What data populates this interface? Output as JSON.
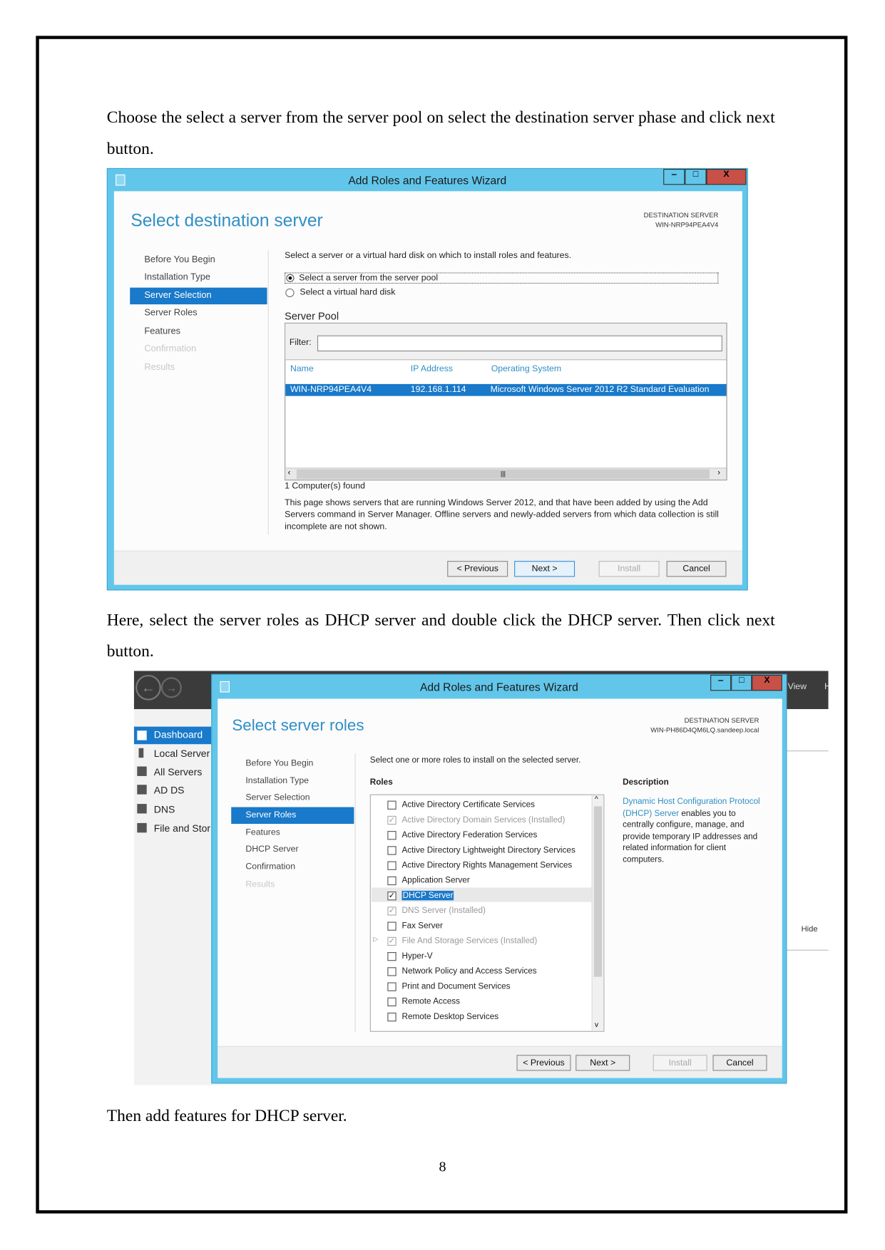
{
  "paragraphs": {
    "p1": "Choose the select a server from the server pool on select the destination server phase and click next button.",
    "p2": "Here, select the server roles as DHCP server and double click the DHCP server.  Then click next button.",
    "p3": "Then add features for DHCP server."
  },
  "page_number": "8",
  "wizard1": {
    "window_title": "Add Roles and Features Wizard",
    "window_buttons": {
      "minimize": "‒",
      "maximize": "□",
      "close": "X"
    },
    "heading": "Select destination server",
    "dest_label": "DESTINATION SERVER",
    "dest_value": "WIN-NRP94PEA4V4",
    "nav": [
      {
        "label": "Before You Begin",
        "state": "normal"
      },
      {
        "label": "Installation Type",
        "state": "normal"
      },
      {
        "label": "Server Selection",
        "state": "selected"
      },
      {
        "label": "Server Roles",
        "state": "normal"
      },
      {
        "label": "Features",
        "state": "normal"
      },
      {
        "label": "Confirmation",
        "state": "disabled"
      },
      {
        "label": "Results",
        "state": "disabled"
      }
    ],
    "instruction": "Select a server or a virtual hard disk on which to install roles and features.",
    "radio_pool": "Select a server from the server pool",
    "radio_vhd": "Select a virtual hard disk",
    "radio_selected": "pool",
    "pool_label": "Server Pool",
    "filter_label": "Filter:",
    "filter_value": "",
    "columns": [
      "Name",
      "IP Address",
      "Operating System"
    ],
    "rows": [
      [
        "WIN-NRP94PEA4V4",
        "192.168.1.114",
        "Microsoft Windows Server 2012 R2 Standard Evaluation"
      ]
    ],
    "found": "1 Computer(s) found",
    "note": "This page shows servers that are running Windows Server 2012, and that have been added by using the Add Servers command in Server Manager. Offline servers and newly-added servers from which data collection is still incomplete are not shown.",
    "buttons": {
      "previous": "< Previous",
      "next": "Next >",
      "install": "Install",
      "cancel": "Cancel"
    }
  },
  "wizard2": {
    "window_title": "Add Roles and Features Wizard",
    "window_buttons": {
      "minimize": "‒",
      "maximize": "□",
      "close": "X"
    },
    "heading": "Select server roles",
    "dest_label": "DESTINATION SERVER",
    "dest_value": "WIN-PH86D4QM6LQ.sandeep.local",
    "nav": [
      {
        "label": "Before You Begin",
        "state": "normal"
      },
      {
        "label": "Installation Type",
        "state": "normal"
      },
      {
        "label": "Server Selection",
        "state": "normal"
      },
      {
        "label": "Server Roles",
        "state": "selected"
      },
      {
        "label": "Features",
        "state": "normal"
      },
      {
        "label": "DHCP Server",
        "state": "normal"
      },
      {
        "label": "Confirmation",
        "state": "normal"
      },
      {
        "label": "Results",
        "state": "disabled"
      }
    ],
    "instruction": "Select one or more roles to install on the selected server.",
    "roles_label": "Roles",
    "description_label": "Description",
    "roles": [
      {
        "label": "Active Directory Certificate Services",
        "checked": false,
        "installed": false
      },
      {
        "label": "Active Directory Domain Services (Installed)",
        "checked": true,
        "installed": true
      },
      {
        "label": "Active Directory Federation Services",
        "checked": false,
        "installed": false
      },
      {
        "label": "Active Directory Lightweight Directory Services",
        "checked": false,
        "installed": false
      },
      {
        "label": "Active Directory Rights Management Services",
        "checked": false,
        "installed": false
      },
      {
        "label": "Application Server",
        "checked": false,
        "installed": false
      },
      {
        "label": "DHCP Server",
        "checked": true,
        "installed": false,
        "highlighted": true
      },
      {
        "label": "DNS Server (Installed)",
        "checked": true,
        "installed": true
      },
      {
        "label": "Fax Server",
        "checked": false,
        "installed": false
      },
      {
        "label": "File And Storage Services (Installed)",
        "checked": true,
        "installed": true,
        "expandable": true
      },
      {
        "label": "Hyper-V",
        "checked": false,
        "installed": false
      },
      {
        "label": "Network Policy and Access Services",
        "checked": false,
        "installed": false
      },
      {
        "label": "Print and Document Services",
        "checked": false,
        "installed": false
      },
      {
        "label": "Remote Access",
        "checked": false,
        "installed": false
      },
      {
        "label": "Remote Desktop Services",
        "checked": false,
        "installed": false
      }
    ],
    "description_link": "Dynamic Host Configuration Protocol (DHCP) Server",
    "description_text": " enables you to centrally configure, manage, and provide temporary IP addresses and related information for client computers.",
    "buttons": {
      "previous": "< Previous",
      "next": "Next >",
      "install": "Install",
      "cancel": "Cancel"
    },
    "server_manager": {
      "sidebar": [
        "Dashboard",
        "Local Server",
        "All Servers",
        "AD DS",
        "DNS",
        "File and Stor"
      ],
      "selected": "Dashboard",
      "menu_view": "View",
      "menu_h": "H",
      "hide": "Hide"
    }
  },
  "colors": {
    "titlebar": "#62c6ea",
    "selected": "#1979ca",
    "heading": "#2f8fc6",
    "close": "#c75047"
  }
}
